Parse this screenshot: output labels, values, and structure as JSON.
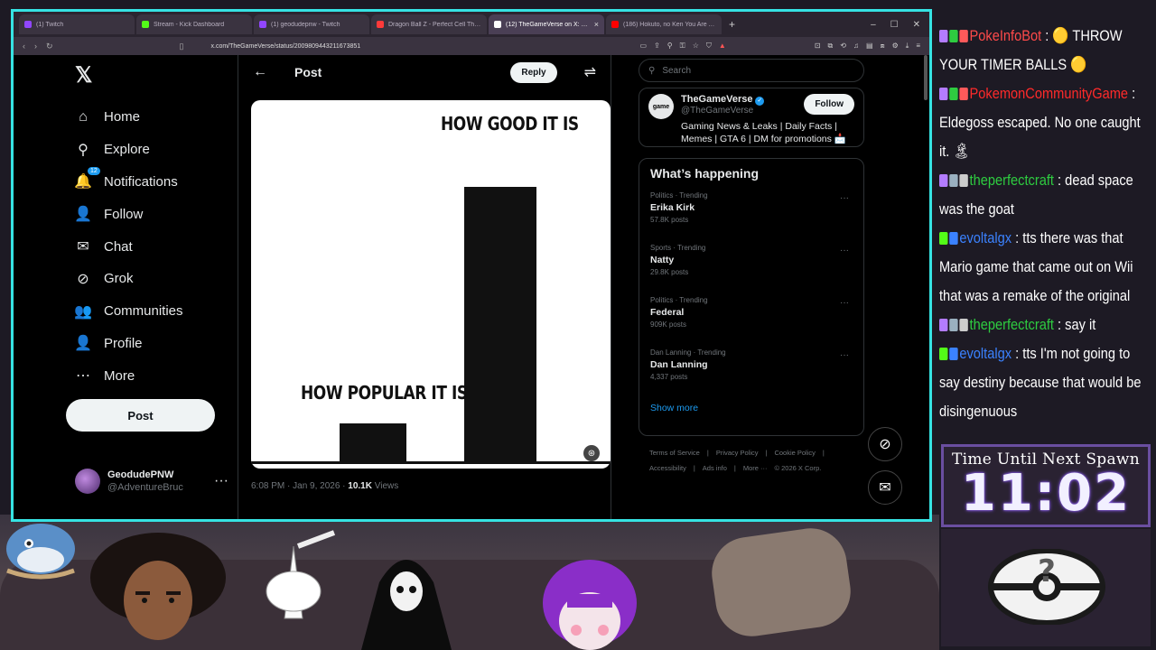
{
  "browser": {
    "tabs": [
      {
        "label": "(1) Twitch",
        "color": "#9146ff",
        "active": false
      },
      {
        "label": "Stream - Kick Dashboard",
        "color": "#53fc18",
        "active": false
      },
      {
        "label": "(1) geodudepnw - Twitch",
        "color": "#9146ff",
        "active": false
      },
      {
        "label": "Dragon Ball Z - Perfect Cell The...",
        "color": "#ff3a3a",
        "active": false
      },
      {
        "label": "(12) TheGameVerse on X: \"When...",
        "color": "#ffffff",
        "active": true
      },
      {
        "label": "(186) Hokuto, no Ken You Are Alrea...",
        "color": "#ff0000",
        "active": false
      }
    ],
    "url": "x.com/TheGameVerse/status/2009809443211673851"
  },
  "nav": {
    "logo": "𝕏",
    "items": [
      {
        "label": "Home",
        "icon": "⌂",
        "name": "home"
      },
      {
        "label": "Explore",
        "icon": "⚲",
        "name": "explore"
      },
      {
        "label": "Notifications",
        "icon": "🔔",
        "name": "notifications",
        "badge": "12"
      },
      {
        "label": "Follow",
        "icon": "👤",
        "name": "follow"
      },
      {
        "label": "Chat",
        "icon": "✉",
        "name": "chat"
      },
      {
        "label": "Grok",
        "icon": "⊘",
        "name": "grok"
      },
      {
        "label": "Communities",
        "icon": "👥",
        "name": "communities"
      },
      {
        "label": "Profile",
        "icon": "👤",
        "name": "profile"
      },
      {
        "label": "More",
        "icon": "⋯",
        "name": "more"
      }
    ],
    "post_label": "Post",
    "account": {
      "name": "GeodudePNW",
      "handle": "@AdventureBruc"
    }
  },
  "main": {
    "title": "Post",
    "reply_label": "Reply",
    "media": {
      "label_left": "HOW POPULAR IT IS",
      "label_right": "HOW GOOD IT IS",
      "bar_left_fraction": 0.12,
      "bar_right_fraction": 0.87
    },
    "time": "6:08 PM · Jan 9, 2026 · ",
    "views": "10.1K",
    "views_label": " Views"
  },
  "right": {
    "search_placeholder": "Search",
    "profile": {
      "avatar_text": "game",
      "name": "TheGameVerse",
      "handle": "@TheGameVerse",
      "bio": "Gaming News & Leaks | Daily Facts | Memes | GTA 6 | DM for promotions 📩",
      "follow_label": "Follow"
    },
    "happening_title": "What’s happening",
    "trends": [
      {
        "category": "Politics · Trending",
        "name": "Erika Kirk",
        "posts": "57.8K posts"
      },
      {
        "category": "Sports · Trending",
        "name": "Natty",
        "posts": "29.8K posts"
      },
      {
        "category": "Politics · Trending",
        "name": "Federal",
        "posts": "909K posts"
      },
      {
        "category": "Dan Lanning · Trending",
        "name": "Dan Lanning",
        "posts": "4,337 posts"
      }
    ],
    "show_more": "Show more",
    "footer": [
      "Terms of Service",
      "|",
      "Privacy Policy",
      "|",
      "Cookie Policy",
      "|",
      "Accessibility",
      "|",
      "Ads info",
      "|",
      "More ···",
      "© 2026 X Corp."
    ]
  },
  "chat": {
    "messages": [
      {
        "user": "PokeInfoBot",
        "user_color": "#ff4a4a",
        "badges": [
          "#b37cff",
          "#2ecc40",
          "#ff5a5a"
        ],
        "text": " : 🟡 THROW YOUR TIMER BALLS 🟡"
      },
      {
        "user": "PokemonCommunityGame",
        "user_color": "#ff2a2a",
        "badges": [
          "#b37cff",
          "#2ecc40",
          "#ff5a5a"
        ],
        "text": " : Eldegoss escaped. No one caught it. 🏝"
      },
      {
        "user": "theperfectcraft",
        "user_color": "#2ecc40",
        "badges": [
          "#b37cff",
          "#9ab0c0",
          "#cccccc"
        ],
        "text": " : dead space was the goat"
      },
      {
        "user": "evoltalgx",
        "user_color": "#3b82ff",
        "badges": [
          "#53fc18",
          "#3b82ff"
        ],
        "text": " : tts there was that Mario game that came out on Wii that was a remake of the original"
      },
      {
        "user": "theperfectcraft",
        "user_color": "#2ecc40",
        "badges": [
          "#b37cff",
          "#9ab0c0",
          "#cccccc"
        ],
        "text": " : say it"
      },
      {
        "user": "evoltalgx",
        "user_color": "#3b82ff",
        "badges": [
          "#53fc18",
          "#3b82ff"
        ],
        "text": " : tts I'm not going to say destiny because that would be disingenuous"
      }
    ]
  },
  "timer": {
    "label": "Time Until Next Spawn",
    "value": "11:02"
  }
}
